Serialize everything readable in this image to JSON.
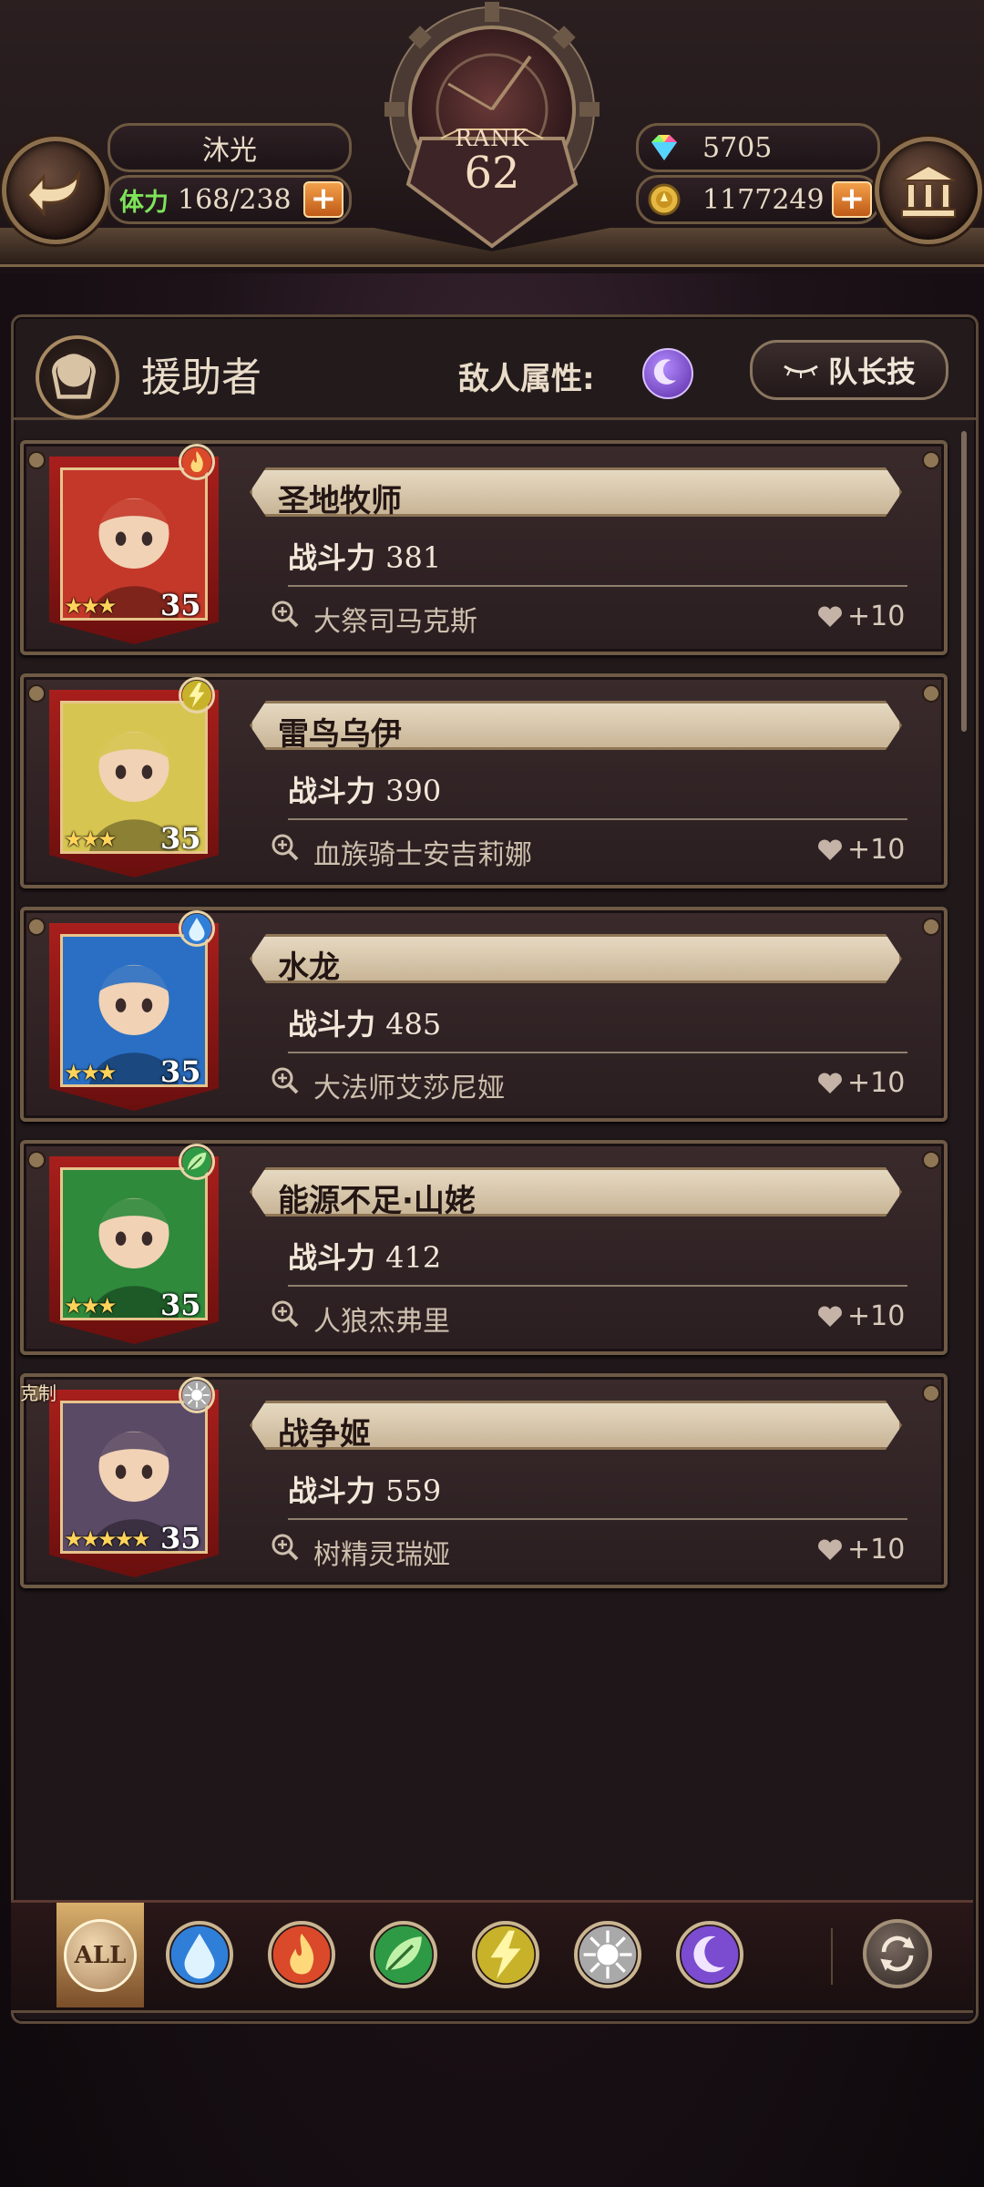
{
  "header": {
    "player_name": "沐光",
    "stamina_label": "体力",
    "stamina_value": "168/238",
    "rank_label": "RANK",
    "rank_value": "62",
    "gems": "5705",
    "gold": "1177249",
    "plus": "+"
  },
  "panel": {
    "title": "援助者",
    "enemy_attr_label": "敌人属性:",
    "enemy_attr_icon": "moon-icon",
    "leader_skill_button": "队长技"
  },
  "helpers": [
    {
      "name": "圣地牧师",
      "power_label": "战斗力",
      "power": "381",
      "leader": "大祭司马克斯",
      "stars": "★★★",
      "level": "35",
      "attribute": "fire",
      "friend": "+10",
      "portrait_color": "#c4382a"
    },
    {
      "name": "雷鸟乌伊",
      "power_label": "战斗力",
      "power": "390",
      "leader": "血族骑士安吉莉娜",
      "stars": "★★★",
      "level": "35",
      "attribute": "thunder",
      "friend": "+10",
      "portrait_color": "#d7c552"
    },
    {
      "name": "水龙",
      "power_label": "战斗力",
      "power": "485",
      "leader": "大法师艾莎尼娅",
      "stars": "★★★",
      "level": "35",
      "attribute": "water",
      "friend": "+10",
      "portrait_color": "#2a6fc4"
    },
    {
      "name": "能源不足·山姥",
      "power_label": "战斗力",
      "power": "412",
      "leader": "人狼杰弗里",
      "stars": "★★★",
      "level": "35",
      "attribute": "wood",
      "friend": "+10",
      "portrait_color": "#2f8a3c"
    },
    {
      "name": "战争姬",
      "power_label": "战斗力",
      "power": "559",
      "leader": "树精灵瑞娅",
      "stars": "★★★★★",
      "level": "35",
      "attribute": "light",
      "friend": "+10",
      "portrait_color": "#5a4a66",
      "tag": "克制"
    }
  ],
  "filter": {
    "all_label": "ALL",
    "attributes": [
      "water",
      "fire",
      "wood",
      "thunder",
      "light",
      "dark"
    ]
  },
  "colors": {
    "fire": "#d9492a",
    "water": "#2f7fd8",
    "wood": "#2f9a45",
    "thunder": "#c7b22a",
    "light": "#a9a9a9",
    "dark": "#7b4bd0",
    "frame_gold": "#a88a62"
  }
}
